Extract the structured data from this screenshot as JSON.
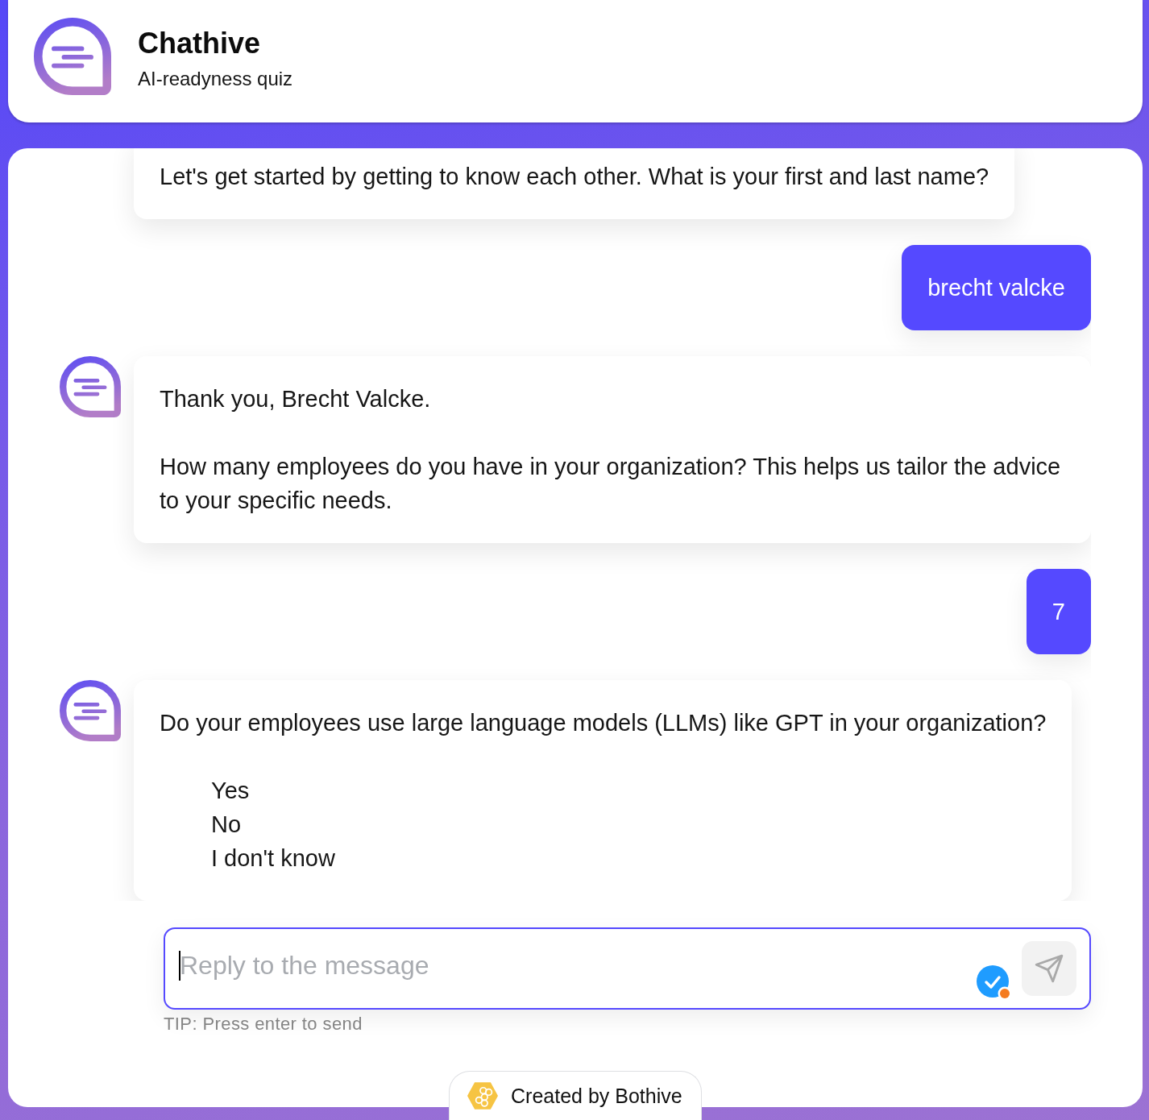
{
  "header": {
    "title": "Chathive",
    "subtitle": "AI-readyness quiz"
  },
  "messages": [
    {
      "kind": "bot",
      "avatar": false,
      "paragraphs": [
        "Let's get started by getting to know each other. What is your first and last name?"
      ]
    },
    {
      "kind": "user",
      "text": "brecht valcke"
    },
    {
      "kind": "bot",
      "avatar": true,
      "paragraphs": [
        "Thank you, Brecht Valcke.",
        "How many employees do you have in your organization? This helps us tailor the advice to your specific needs."
      ]
    },
    {
      "kind": "user",
      "text": "7"
    },
    {
      "kind": "bot",
      "avatar": true,
      "paragraphs": [
        "Do your employees use large language models (LLMs) like GPT in your organization?"
      ],
      "options": [
        "Yes",
        "No",
        "I don't know"
      ]
    }
  ],
  "composer": {
    "placeholder": "Reply to the message",
    "focused": true,
    "tip": "TIP: Press enter to send"
  },
  "footer": {
    "text": "Created by Bothive"
  }
}
